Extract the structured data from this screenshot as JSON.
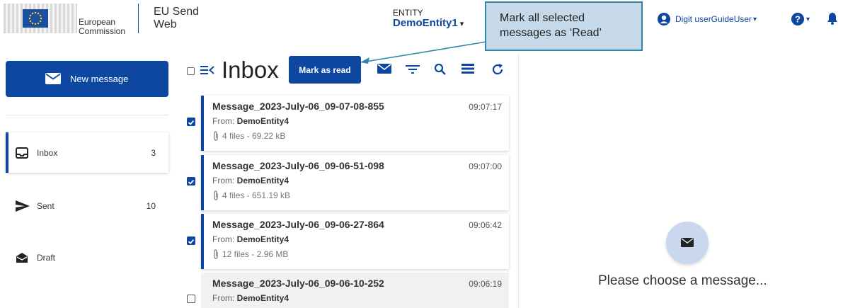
{
  "header": {
    "logo_line1": "European",
    "logo_line2": "Commission",
    "app_title_line1": "EU Send",
    "app_title_line2": "Web",
    "entity_label": "ENTITY",
    "entity_value": "DemoEntity1",
    "user_name": "Digit userGuideUser",
    "caret": "▾"
  },
  "callout": {
    "line1": "Mark all selected",
    "line2": "messages as ‘Read’"
  },
  "sidebar": {
    "new_message_label": "New message",
    "items": [
      {
        "label": "Inbox",
        "count": "3"
      },
      {
        "label": "Sent",
        "count": "10"
      },
      {
        "label": "Draft",
        "count": ""
      }
    ]
  },
  "list": {
    "title": "Inbox",
    "mark_read_label": "Mark as read",
    "from_prefix": "From: ",
    "messages": [
      {
        "subject": "Message_2023-July-06_09-07-08-855",
        "time": "09:07:17",
        "from": "DemoEntity4",
        "attachments": "4 files - 69.22 kB",
        "selected": true
      },
      {
        "subject": "Message_2023-July-06_09-06-51-098",
        "time": "09:07:00",
        "from": "DemoEntity4",
        "attachments": "4 files - 651.19 kB",
        "selected": true
      },
      {
        "subject": "Message_2023-July-06_09-06-27-864",
        "time": "09:06:42",
        "from": "DemoEntity4",
        "attachments": "12 files - 2.96 MB",
        "selected": true
      },
      {
        "subject": "Message_2023-July-06_09-06-10-252",
        "time": "09:06:19",
        "from": "DemoEntity4",
        "attachments": "",
        "selected": false
      }
    ]
  },
  "reading_pane": {
    "empty_text": "Please choose a message..."
  },
  "colors": {
    "primary": "#0e47a1",
    "callout_bg": "#c6d9e8",
    "callout_border": "#2e86ab"
  },
  "icons": [
    "eu-flag-icon",
    "user-icon",
    "help-icon",
    "bell-icon",
    "envelope-icon",
    "menu-toggle-icon",
    "filter-icon",
    "search-icon",
    "list-icon",
    "refresh-icon",
    "inbox-icon",
    "send-icon",
    "draft-icon",
    "paperclip-icon",
    "check-icon"
  ]
}
